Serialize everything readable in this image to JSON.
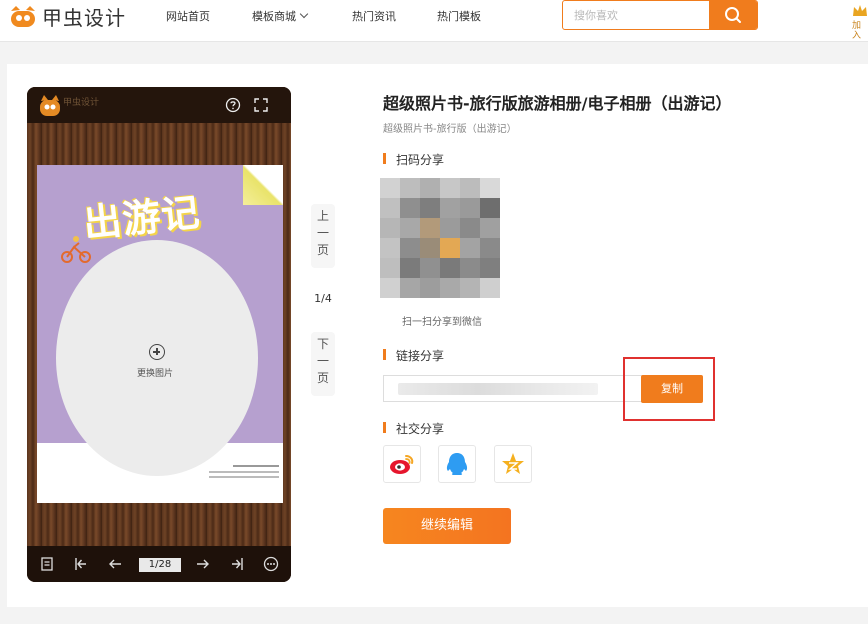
{
  "header": {
    "logo_text": "甲虫设计",
    "nav": [
      "网站首页",
      "模板商城",
      "热门资讯",
      "热门模板"
    ],
    "search_placeholder": "搜你喜欢",
    "crown_text": "加入"
  },
  "preview": {
    "cover_title": "出游记",
    "replace_label": "更换图片",
    "page_indicator": "1/28"
  },
  "side_pager": {
    "prev_label": [
      "上",
      "一",
      "页"
    ],
    "count": "1/4",
    "next_label": [
      "下",
      "一",
      "页"
    ]
  },
  "detail": {
    "title": "超级照片书-旅行版旅游相册/电子相册（出游记）",
    "subtitle": "超级照片书-旅行版（出游记）",
    "qr_section": "扫码分享",
    "qr_caption": "扫一扫分享到微信",
    "link_section": "链接分享",
    "copy_label": "复制",
    "social_section": "社交分享",
    "edit_label": "继续编辑"
  },
  "colors": {
    "accent": "#f07c1d",
    "highlight": "#e0312f"
  }
}
